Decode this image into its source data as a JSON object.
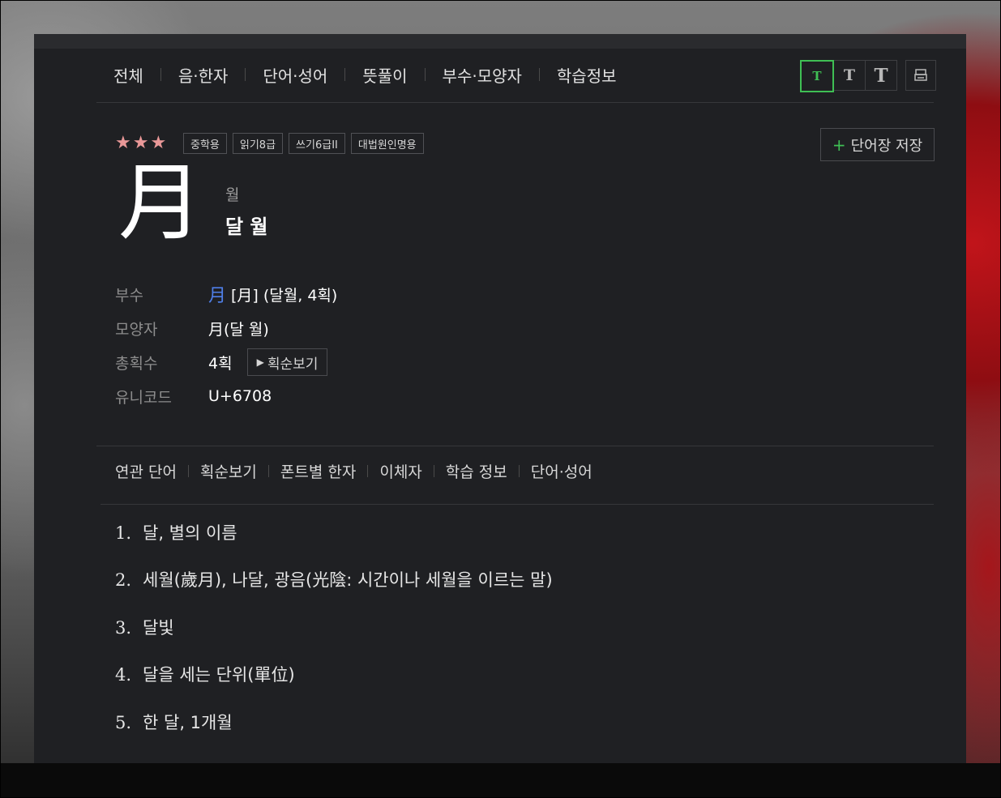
{
  "nav": {
    "items": [
      "전체",
      "음·한자",
      "단어·성어",
      "뜻풀이",
      "부수·모양자",
      "학습정보"
    ],
    "font_sizes": [
      "T",
      "T",
      "T"
    ],
    "print_icon": "print-icon"
  },
  "entry": {
    "stars": "★★★",
    "tags": [
      "중학용",
      "읽기8급",
      "쓰기6급II",
      "대법원인명용"
    ],
    "save_label": "단어장 저장",
    "hanja": "月",
    "reading": "월",
    "meaning": "달 월"
  },
  "info": {
    "radical_label": "부수",
    "radical_link": "月",
    "radical_value": "[月] (달월, 4획)",
    "shape_label": "모양자",
    "shape_value": "月(달 월)",
    "strokes_label": "총획수",
    "strokes_value": "4획",
    "stroke_button": "획순보기",
    "unicode_label": "유니코드",
    "unicode_value": "U+6708"
  },
  "subnav": {
    "items": [
      "연관 단어",
      "획순보기",
      "폰트별 한자",
      "이체자",
      "학습 정보",
      "단어·성어"
    ]
  },
  "definitions": [
    {
      "num": "1.",
      "text": "달, 별의 이름"
    },
    {
      "num": "2.",
      "text": "세월(歲月), 나달, 광음(光陰: 시간이나 세월을 이르는 말)"
    },
    {
      "num": "3.",
      "text": "달빛"
    },
    {
      "num": "4.",
      "text": "달을 세는 단위(單位)"
    },
    {
      "num": "5.",
      "text": "한 달, 1개월"
    }
  ],
  "colors": {
    "panel_bg": "#1f2023",
    "accent_green": "#3fbf54",
    "star_pink": "#e99898",
    "link_blue": "#4f7fe8"
  }
}
